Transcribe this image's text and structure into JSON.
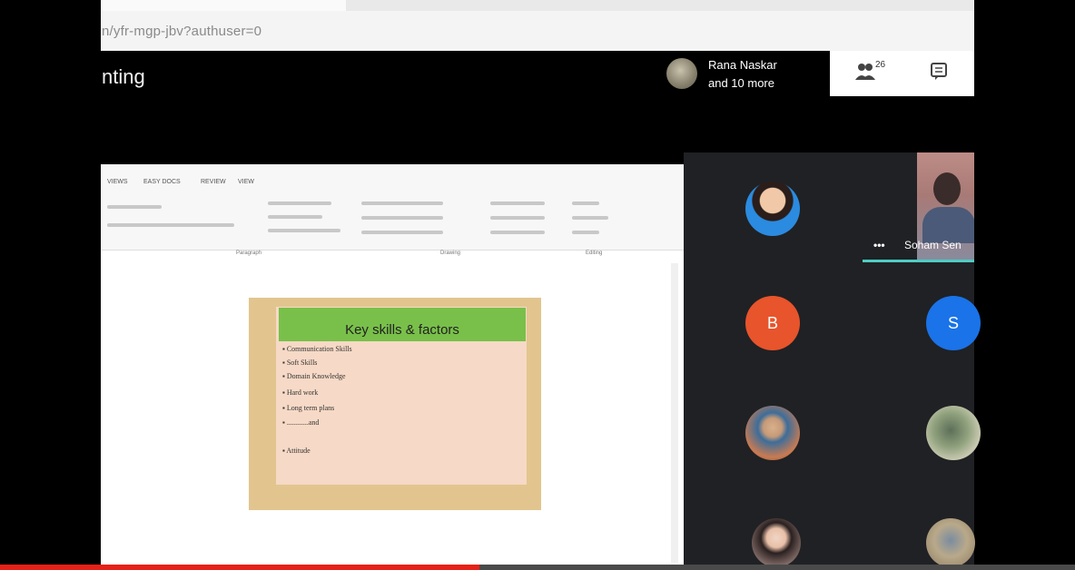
{
  "browser": {
    "url_fragment": "n/yfr-mgp-jbv?authuser=0"
  },
  "meeting": {
    "title_fragment": "nting",
    "presenter": {
      "line1": "Rana Naskar",
      "line2": "and 10 more"
    },
    "people_count": "26"
  },
  "shared_screen": {
    "ribbon_tabs": [
      "VIEWS",
      "EASY DOCS",
      "REVIEW",
      "VIEW"
    ],
    "ribbon_groups": [
      "Paragraph",
      "Drawing",
      "Editing"
    ],
    "slide": {
      "title": "Key skills & factors",
      "bullets": [
        "Communication Skills",
        "Soft Skills",
        "Domain Knowledge",
        "Hard work",
        "Long term plans",
        "............and",
        "Attitude"
      ]
    }
  },
  "participants": {
    "video_tile_name": "Soham Sen",
    "letter_tiles": [
      "B",
      "S"
    ]
  },
  "colors": {
    "accent_speaking": "#4ecdc4",
    "progress_red": "#e62117",
    "avatar_b": "#e8542b",
    "avatar_s": "#1a73e8"
  },
  "playback": {
    "progress": 0.446
  }
}
